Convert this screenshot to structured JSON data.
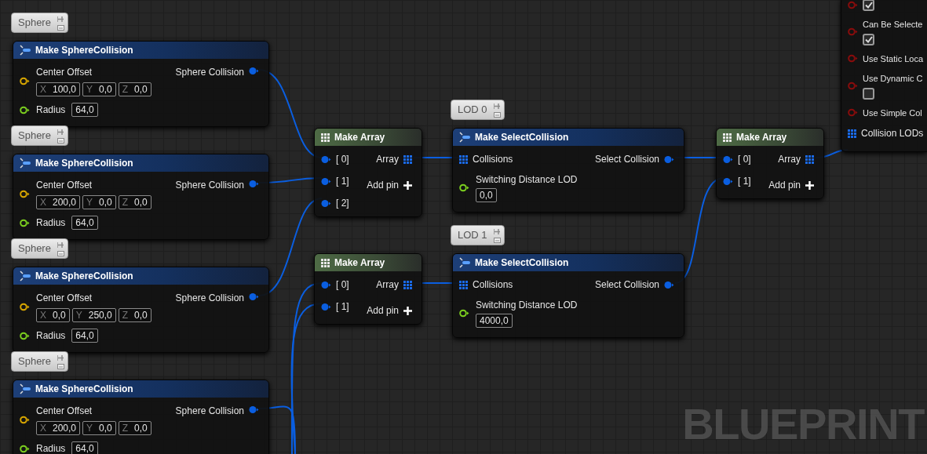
{
  "sphere_nodes": [
    {
      "comment": "Sphere",
      "title": "Make SphereCollision",
      "vector_label": "Center Offset",
      "vector": [
        {
          "axis": "X",
          "value": "100,0"
        },
        {
          "axis": "Y",
          "value": "0,0"
        },
        {
          "axis": "Z",
          "value": "0,0"
        }
      ],
      "radius_label": "Radius",
      "radius_value": "64,0",
      "output_label": "Sphere Collision"
    },
    {
      "comment": "Sphere",
      "title": "Make SphereCollision",
      "vector_label": "Center Offset",
      "vector": [
        {
          "axis": "X",
          "value": "200,0"
        },
        {
          "axis": "Y",
          "value": "0,0"
        },
        {
          "axis": "Z",
          "value": "0,0"
        }
      ],
      "radius_label": "Radius",
      "radius_value": "64,0",
      "output_label": "Sphere Collision"
    },
    {
      "comment": "Sphere",
      "title": "Make SphereCollision",
      "vector_label": "Center Offset",
      "vector": [
        {
          "axis": "X",
          "value": "0,0"
        },
        {
          "axis": "Y",
          "value": "250,0"
        },
        {
          "axis": "Z",
          "value": "0,0"
        }
      ],
      "radius_label": "Radius",
      "radius_value": "64,0",
      "output_label": "Sphere Collision"
    },
    {
      "comment": "Sphere",
      "title": "Make SphereCollision",
      "vector_label": "Center Offset",
      "vector": [
        {
          "axis": "X",
          "value": "200,0"
        },
        {
          "axis": "Y",
          "value": "0,0"
        },
        {
          "axis": "Z",
          "value": "0,0"
        }
      ],
      "radius_label": "Radius",
      "radius_value": "64,0",
      "output_label": "Sphere Collision"
    }
  ],
  "array_nodes": [
    {
      "title": "Make Array",
      "inputs": [
        "[ 0]",
        "[ 1]",
        "[ 2]"
      ],
      "output_label": "Array",
      "add_pin_label": "Add pin"
    },
    {
      "title": "Make Array",
      "inputs": [
        "[ 0]",
        "[ 1]"
      ],
      "output_label": "Array",
      "add_pin_label": "Add pin"
    },
    {
      "title": "Make Array",
      "inputs": [
        "[ 0]",
        "[ 1]"
      ],
      "output_label": "Array",
      "add_pin_label": "Add pin"
    }
  ],
  "select_nodes": [
    {
      "comment": "LOD 0",
      "title": "Make SelectCollision",
      "input_label": "Collisions",
      "output_label": "Select Collision",
      "distance_label": "Switching Distance LOD",
      "distance_value": "0,0"
    },
    {
      "comment": "LOD 1",
      "title": "Make SelectCollision",
      "input_label": "Collisions",
      "output_label": "Select Collision",
      "distance_label": "Switching Distance LOD",
      "distance_value": "4000,0"
    }
  ],
  "settings_node": {
    "rows": [
      {
        "kind": "checkbox",
        "checked": true
      },
      {
        "kind": "checkbox",
        "label": "Can Be Selecte",
        "checked": true
      },
      {
        "kind": "pin",
        "label": "Use Static Loca"
      },
      {
        "kind": "checkbox",
        "label": "Use Dynamic C",
        "checked": false
      },
      {
        "kind": "pin",
        "label": "Use Simple Col"
      }
    ],
    "output_label": "Collision LODs"
  },
  "graph_label": "BLUEPRINT"
}
